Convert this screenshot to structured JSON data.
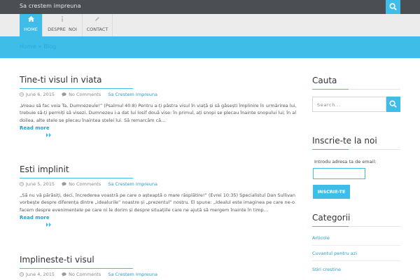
{
  "site": {
    "title": "Sa crestem impreuna"
  },
  "nav": {
    "items": [
      {
        "label": "HOME",
        "icon": "home-icon"
      },
      {
        "label": "DESPRE  NOI",
        "icon": "info-icon"
      },
      {
        "label": "CONTACT",
        "icon": "pencil-icon"
      }
    ],
    "active": "HOME"
  },
  "breadcrumb": {
    "home": "Home",
    "separator": "»",
    "current": "Blog"
  },
  "posts": [
    {
      "title": "Tine-ti visul in viata",
      "date": "June 6, 2015",
      "comments": "No Comments",
      "category": "Sa Crestem Impreuna",
      "excerpt": "„Vreau să fac voia Ta, Dumnezeule!” (Psalmul 40:8) Pentru a-ți păstra visul în viață și să găsești împlinire în urmărirea lui, trebuie să-ți permiți să visezi. Dumnezeu i-a dat lui Iosif două vise: în primul, ați snopi se plecau înainte snopului lui; în al doilea, alte stele se plecau înaintea stelei lui. Să remarcăm că…",
      "read_more": "Read more"
    },
    {
      "title": "Esti implinit",
      "date": "June 5, 2015",
      "comments": "No Comments",
      "category": "Sa Crestem Impreuna",
      "excerpt": "„Să nu vă părăsiți, deci, încrederea voastră pe care o așteaptă o mare răsplătire!” (Evrei 10:35) Specialistul Dan Sullivan vorbește despre diferența dintre „idealurile” noastre și „prezentul” nostru. El spune: „Idealul este imaginea pe care ne-o facem despre evenimentele pe care ni le dorim și despre situațiile care ne ajută să mergem înainte în timp…",
      "read_more": "Read more"
    },
    {
      "title": "Implineste-ti visul",
      "date": "June 4, 2015",
      "comments": "No Comments",
      "category": "Sa Crestem Impreuna"
    }
  ],
  "sidebar": {
    "search": {
      "title": "Cauta",
      "placeholder": "Search..."
    },
    "subscribe": {
      "title": "Inscrie-te la noi",
      "label": "Introdu adresa ta de email:",
      "button": "INSCRIE-TE"
    },
    "categories": {
      "title": "Categorii",
      "items": [
        "Articole",
        "Cuvantul pentru azi",
        "Stiri crestine"
      ]
    }
  },
  "colors": {
    "accent": "#3dbde8",
    "topbar": "#4b4f54",
    "nav_bg": "#ececec",
    "link": "#2a9bd0"
  }
}
